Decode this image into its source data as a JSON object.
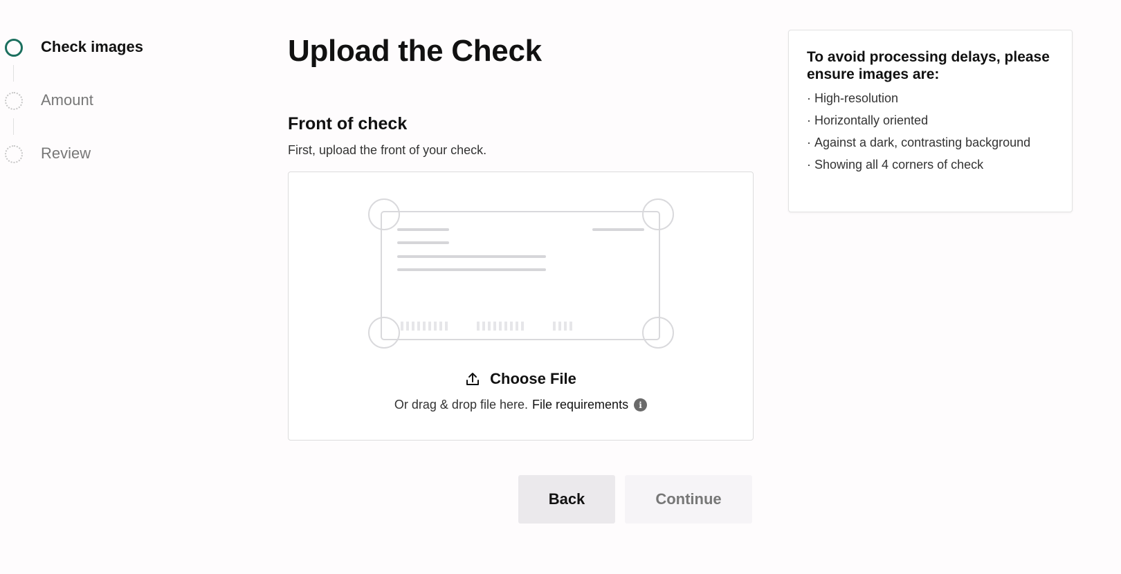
{
  "stepper": {
    "steps": [
      {
        "label": "Check images",
        "state": "active"
      },
      {
        "label": "Amount",
        "state": "pending"
      },
      {
        "label": "Review",
        "state": "pending"
      }
    ]
  },
  "main": {
    "title": "Upload the Check",
    "section_title": "Front of check",
    "section_description": "First, upload the front of your check.",
    "dropzone": {
      "choose_file_label": "Choose File",
      "drop_hint": "Or drag & drop file here.",
      "file_requirements_label": "File requirements",
      "upload_icon": "upload-icon",
      "info_icon": "info-icon"
    },
    "actions": {
      "back_label": "Back",
      "continue_label": "Continue"
    }
  },
  "tips": {
    "title": "To avoid processing delays, please ensure images are:",
    "items": [
      "High-resolution",
      "Horizontally oriented",
      "Against a dark, contrasting background",
      "Showing all 4 corners of check"
    ]
  },
  "colors": {
    "accent": "#1b6f5e",
    "background": "#fefcfd",
    "back_button_bg": "#ebe9ec",
    "continue_button_bg": "#f6f4f7"
  }
}
